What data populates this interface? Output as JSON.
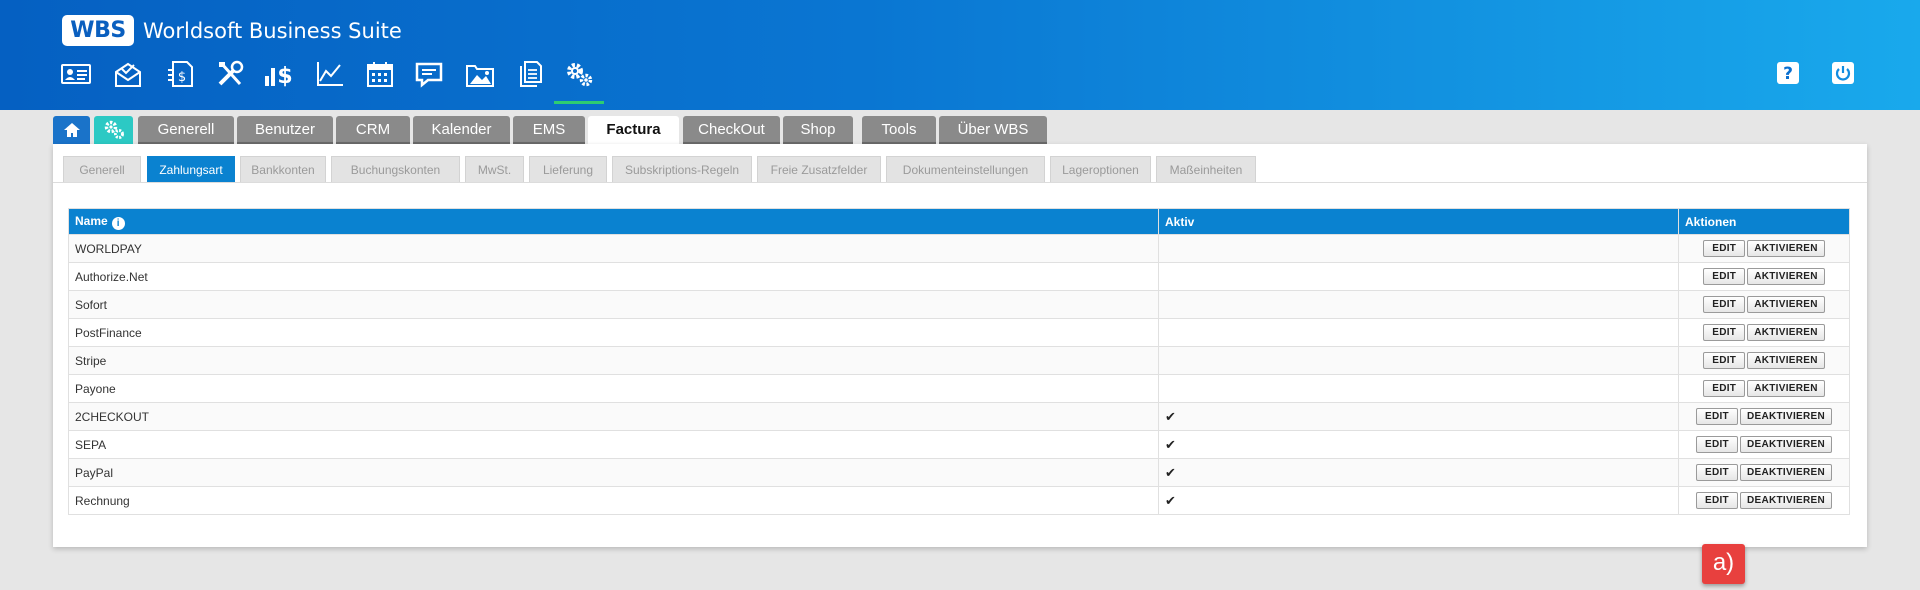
{
  "app": {
    "logo": "WBS",
    "title": "Worldsoft Business Suite"
  },
  "nav_icons": [
    "contact-card-icon",
    "mail-icon",
    "invoice-icon",
    "tools-icon",
    "finance-icon",
    "chart-icon",
    "calendar-icon",
    "chat-icon",
    "photos-icon",
    "documents-icon",
    "settings-gears-icon"
  ],
  "header_right": [
    "help-icon",
    "power-icon"
  ],
  "tabs": [
    "Generell",
    "Benutzer",
    "CRM",
    "Kalender",
    "EMS",
    "Factura",
    "CheckOut",
    "Shop",
    "Tools",
    "Über WBS"
  ],
  "active_tab": "Factura",
  "subtabs": [
    "Generell",
    "Zahlungsart",
    "Bankkonten",
    "Buchungskonten",
    "MwSt.",
    "Lieferung",
    "Subskriptions-Regeln",
    "Freie Zusatzfelder",
    "Dokumenteinstellungen",
    "Lageroptionen",
    "Maßeinheiten"
  ],
  "active_subtab": "Zahlungsart",
  "table": {
    "headers": {
      "name": "Name",
      "aktiv": "Aktiv",
      "aktionen": "Aktionen"
    },
    "rows": [
      {
        "name": "WORLDPAY",
        "aktiv": "",
        "edit": "EDIT",
        "toggle": "AKTIVIEREN"
      },
      {
        "name": "Authorize.Net",
        "aktiv": "",
        "edit": "EDIT",
        "toggle": "AKTIVIEREN"
      },
      {
        "name": "Sofort",
        "aktiv": "",
        "edit": "EDIT",
        "toggle": "AKTIVIEREN"
      },
      {
        "name": "PostFinance",
        "aktiv": "",
        "edit": "EDIT",
        "toggle": "AKTIVIEREN"
      },
      {
        "name": "Stripe",
        "aktiv": "",
        "edit": "EDIT",
        "toggle": "AKTIVIEREN"
      },
      {
        "name": "Payone",
        "aktiv": "",
        "edit": "EDIT",
        "toggle": "AKTIVIEREN"
      },
      {
        "name": "2CHECKOUT",
        "aktiv": "✔",
        "edit": "EDIT",
        "toggle": "DEAKTIVIEREN"
      },
      {
        "name": "SEPA",
        "aktiv": "✔",
        "edit": "EDIT",
        "toggle": "DEAKTIVIEREN"
      },
      {
        "name": "PayPal",
        "aktiv": "✔",
        "edit": "EDIT",
        "toggle": "DEAKTIVIEREN"
      },
      {
        "name": "Rechnung",
        "aktiv": "✔",
        "edit": "EDIT",
        "toggle": "DEAKTIVIEREN"
      }
    ]
  },
  "annotation": {
    "label": "a)"
  },
  "colors": {
    "header_start": "#0560c2",
    "header_end": "#19a9ec",
    "accent": "#0a82d0",
    "badge": "#e8403e"
  }
}
